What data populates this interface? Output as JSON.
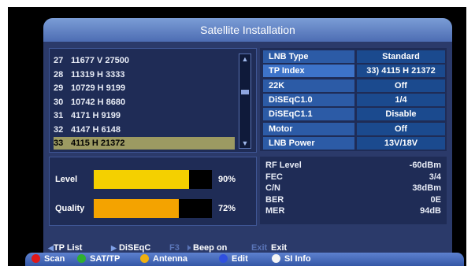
{
  "title": "Satellite Installation",
  "transponders": [
    {
      "num": "27",
      "text": "11677 V 27500"
    },
    {
      "num": "28",
      "text": "11319 H 3333"
    },
    {
      "num": "29",
      "text": "10729 H 9199"
    },
    {
      "num": "30",
      "text": "10742 H 8680"
    },
    {
      "num": "31",
      "text": "4171 H 9199"
    },
    {
      "num": "32",
      "text": "4147 H 6148"
    },
    {
      "num": "33",
      "text": "4115 H 21372"
    }
  ],
  "selected_index": 6,
  "settings": [
    {
      "label": "LNB Type",
      "value": "Standard"
    },
    {
      "label": "TP Index",
      "value": "33) 4115 H 21372"
    },
    {
      "label": "22K",
      "value": "Off"
    },
    {
      "label": "DiSEqC1.0",
      "value": "1/4"
    },
    {
      "label": "DiSEqC1.1",
      "value": "Disable"
    },
    {
      "label": "Motor",
      "value": "Off"
    },
    {
      "label": "LNB Power",
      "value": "13V/18V"
    }
  ],
  "signal": {
    "level": {
      "label": "Level",
      "percent_text": "90%",
      "fraction": 0.9,
      "color": "#f4d000"
    },
    "quality": {
      "label": "Quality",
      "percent_text": "72%",
      "fraction": 0.72,
      "color": "#f4a300"
    }
  },
  "info": [
    {
      "label": "RF Level",
      "value": "-60dBm"
    },
    {
      "label": "FEC",
      "value": "3/4"
    },
    {
      "label": "C/N",
      "value": "38dBm"
    },
    {
      "label": "BER",
      "value": "0E"
    },
    {
      "label": "MER",
      "value": "94dB"
    }
  ],
  "help": {
    "tp_list": "TP List",
    "diseqc": "DiSEqC",
    "f3": "F3",
    "beep": "Beep on",
    "exit_key": "Exit",
    "exit": "Exit"
  },
  "color_buttons": [
    {
      "label": "Scan",
      "color": "#e01818"
    },
    {
      "label": "SAT/TP",
      "color": "#2fb02f"
    },
    {
      "label": "Antenna",
      "color": "#f0b010"
    },
    {
      "label": "Edit",
      "color": "#3050e0"
    },
    {
      "label": "SI Info",
      "color": "#f5f5f5"
    }
  ]
}
